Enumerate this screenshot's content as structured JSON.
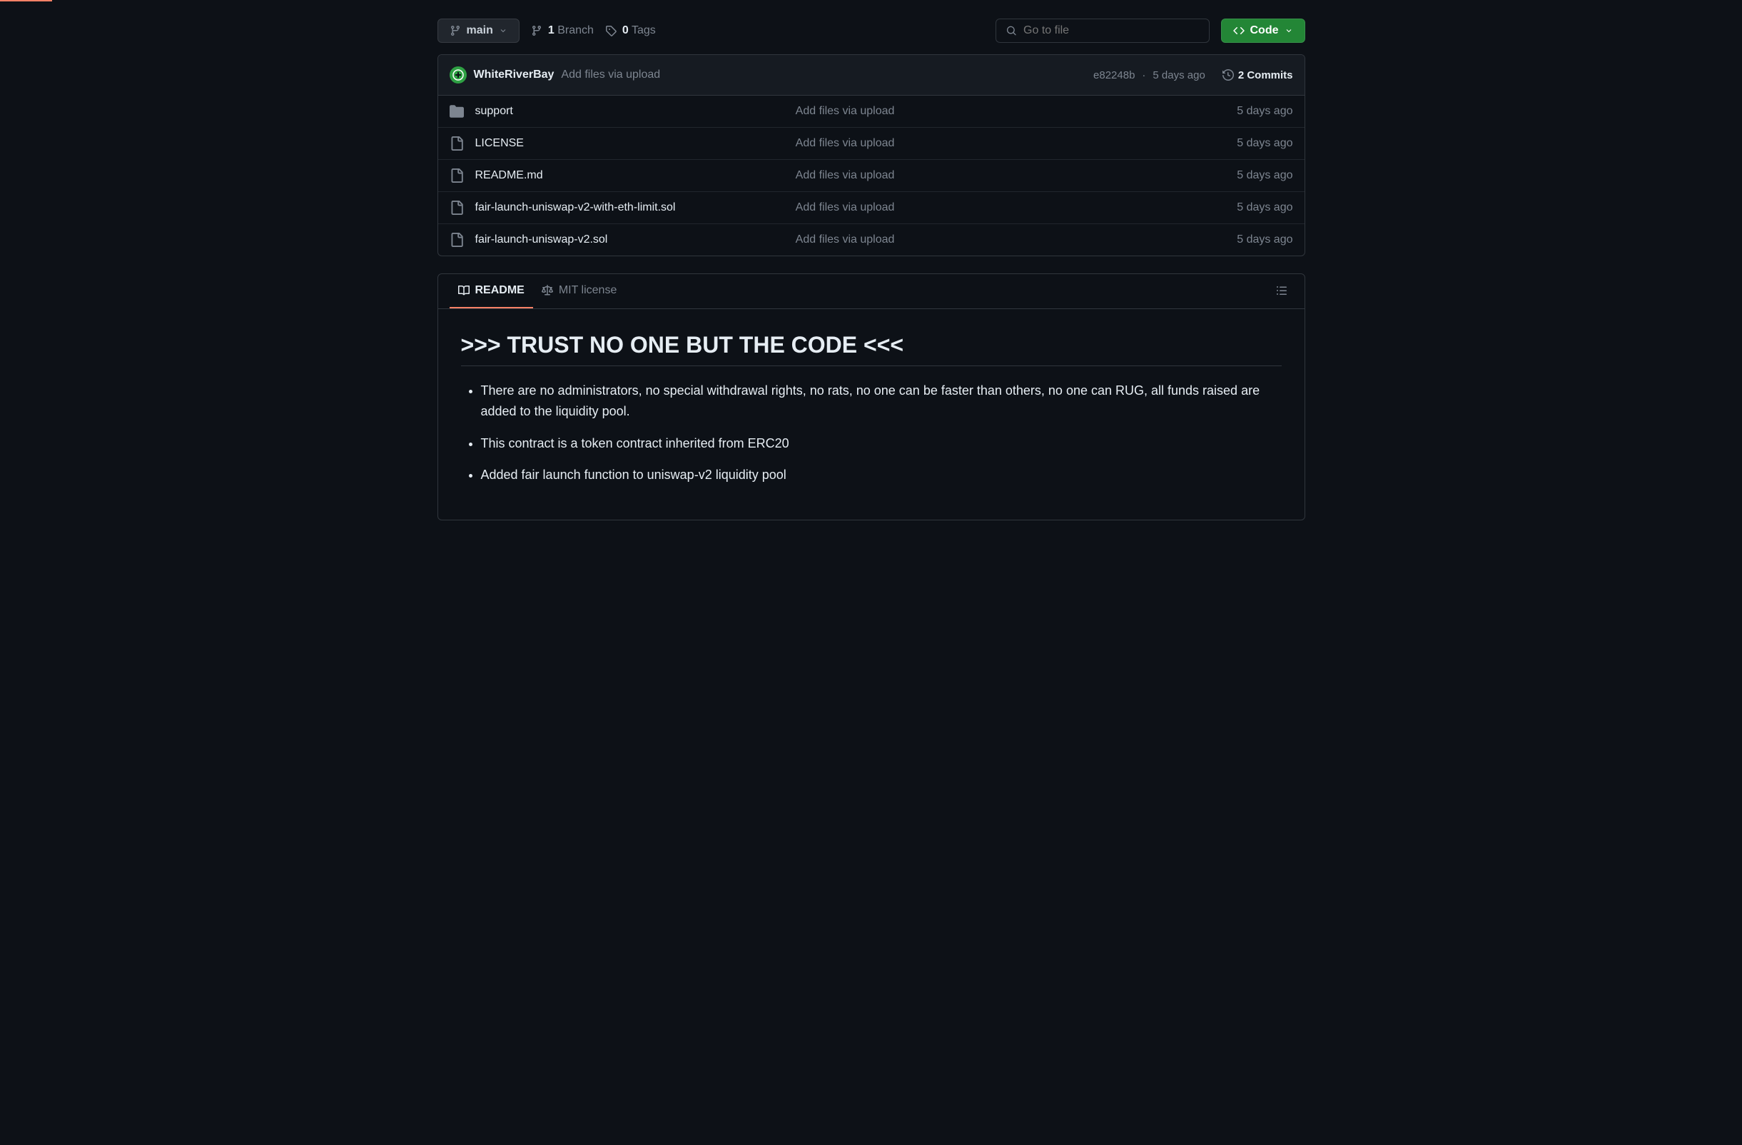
{
  "branch": {
    "name": "main"
  },
  "stats": {
    "branches_count": "1",
    "branches_label": "Branch",
    "tags_count": "0",
    "tags_label": "Tags"
  },
  "search": {
    "placeholder": "Go to file"
  },
  "code_button": "Code",
  "latest_commit": {
    "author": "WhiteRiverBay",
    "message": "Add files via upload",
    "sha": "e82248b",
    "date": "5 days ago",
    "commits_count": "2 Commits"
  },
  "files": [
    {
      "type": "dir",
      "name": "support",
      "commit": "Add files via upload",
      "date": "5 days ago"
    },
    {
      "type": "file",
      "name": "LICENSE",
      "commit": "Add files via upload",
      "date": "5 days ago"
    },
    {
      "type": "file",
      "name": "README.md",
      "commit": "Add files via upload",
      "date": "5 days ago"
    },
    {
      "type": "file",
      "name": "fair-launch-uniswap-v2-with-eth-limit.sol",
      "commit": "Add files via upload",
      "date": "5 days ago"
    },
    {
      "type": "file",
      "name": "fair-launch-uniswap-v2.sol",
      "commit": "Add files via upload",
      "date": "5 days ago"
    }
  ],
  "readme_tabs": {
    "readme": "README",
    "license": "MIT license"
  },
  "readme": {
    "heading": ">>> TRUST NO ONE BUT THE CODE <<<",
    "bullets": [
      "There are no administrators, no special withdrawal rights, no rats, no one can be faster than others, no one can RUG, all funds raised are added to the liquidity pool.",
      "This contract is a token contract inherited from ERC20",
      "Added fair launch function to uniswap-v2 liquidity pool"
    ]
  }
}
